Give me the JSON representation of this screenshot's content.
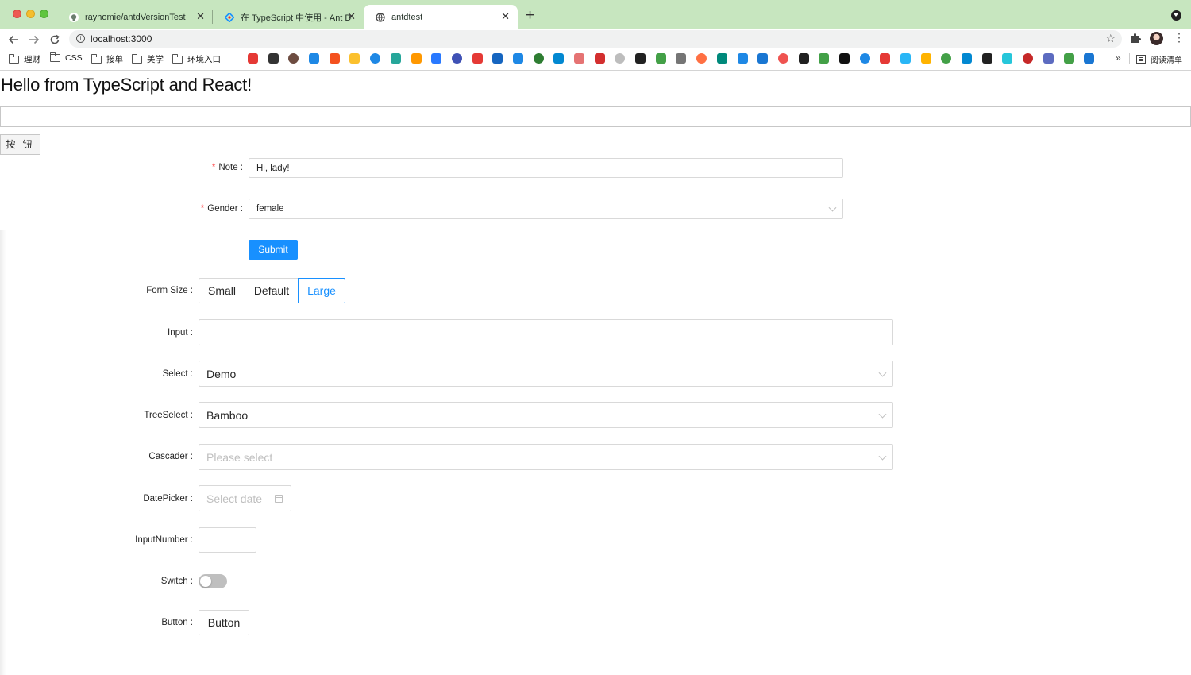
{
  "browser": {
    "tabs": [
      {
        "title": "rayhomie/antdVersionTest",
        "icon": "github-icon"
      },
      {
        "title": "在 TypeScript 中使用 - Ant Design",
        "icon": "ant-design-icon"
      },
      {
        "title": "antdtest",
        "icon": "globe-icon"
      }
    ],
    "new_tab": "+",
    "close_glyph": "✕",
    "url": "localhost:3000",
    "bookmarks": [
      {
        "label": "理财"
      },
      {
        "label": "CSS"
      },
      {
        "label": "接单"
      },
      {
        "label": "美学"
      },
      {
        "label": "环境入口"
      }
    ],
    "bookmark_icon_colors": [
      "#e53935",
      "#333333",
      "#6d4c41",
      "#1e88e5",
      "#f4511e",
      "#fbc02d",
      "#1e88e5",
      "#26a69a",
      "#ff9800",
      "#2979ff",
      "#3f51b5",
      "#e53935",
      "#1565c0",
      "#1e88e5",
      "#2e7d32",
      "#0288d1",
      "#e57373",
      "#d32f2f",
      "#bdbdbd",
      "#212121",
      "#43a047",
      "#757575",
      "#ff7043",
      "#00897b",
      "#1e88e5",
      "#1976d2",
      "#ef5350",
      "#212121",
      "#43a047",
      "#111111",
      "#1e88e5",
      "#e53935",
      "#29b6f6",
      "#ffb300",
      "#43a047",
      "#0288d1",
      "#212121",
      "#26c6da",
      "#c62828",
      "#5c6bc0",
      "#43a047",
      "#1976d2"
    ],
    "more_label": "»",
    "reading_list": "阅读清单"
  },
  "page": {
    "heading": "Hello from TypeScript and React!",
    "raw_button": "按 钮",
    "form1": {
      "note_label": "Note",
      "note_value": "Hi, lady!",
      "gender_label": "Gender",
      "gender_value": "female",
      "submit_label": "Submit"
    },
    "form2": {
      "form_size_label": "Form Size",
      "size_options": [
        "Small",
        "Default",
        "Large"
      ],
      "selected_size": "Large",
      "input_label": "Input",
      "select_label": "Select",
      "select_value": "Demo",
      "treeselect_label": "TreeSelect",
      "treeselect_value": "Bamboo",
      "cascader_label": "Cascader",
      "cascader_placeholder": "Please select",
      "datepicker_label": "DatePicker",
      "datepicker_placeholder": "Select date",
      "inputnumber_label": "InputNumber",
      "switch_label": "Switch",
      "button_label": "Button",
      "button_text": "Button"
    },
    "colors": {
      "primary": "#1890ff",
      "required": "#ff4d4f",
      "tabbar": "#c7e6bf"
    }
  }
}
